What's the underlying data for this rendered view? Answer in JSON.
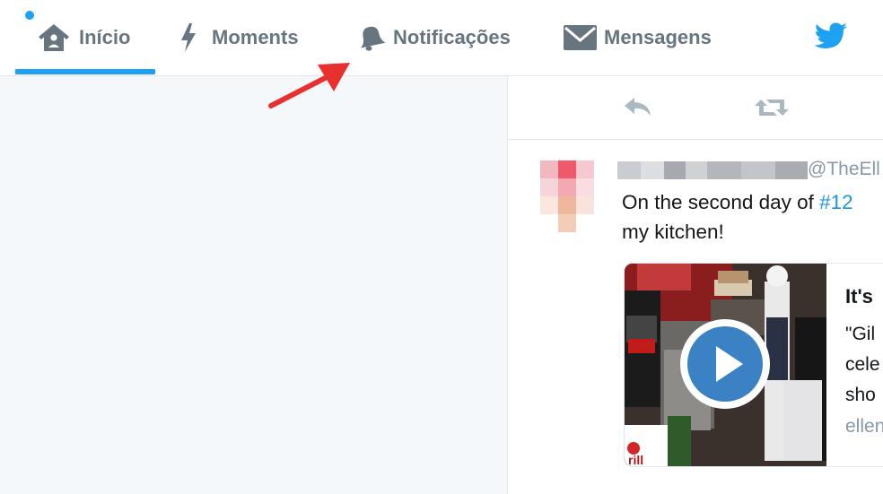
{
  "nav": {
    "home_label": "Início",
    "moments_label": "Moments",
    "notifications_label": "Notificações",
    "messages_label": "Mensagens",
    "home_icon": "house-icon",
    "moments_icon": "lightning-bolt-icon",
    "notifications_icon": "bell-icon",
    "messages_icon": "envelope-icon",
    "brand_icon": "twitter-bird-icon"
  },
  "colors": {
    "accent": "#1da1f2",
    "nav_text": "#66757f",
    "hashtag": "#1b95e0",
    "annotation_arrow": "#e8312f",
    "left_pane_bg": "#f5f8fa"
  },
  "tweet": {
    "handle": "@TheEll",
    "text_part1": "On the second day of ",
    "hashtag": "#12",
    "text_line2": "my kitchen!",
    "actions": [
      "reply-icon",
      "retweet-icon"
    ],
    "card": {
      "title": "It's",
      "desc_line1": "\"Gil",
      "desc_line2": "cele",
      "desc_line3": "sho",
      "domain": "ellen"
    }
  }
}
